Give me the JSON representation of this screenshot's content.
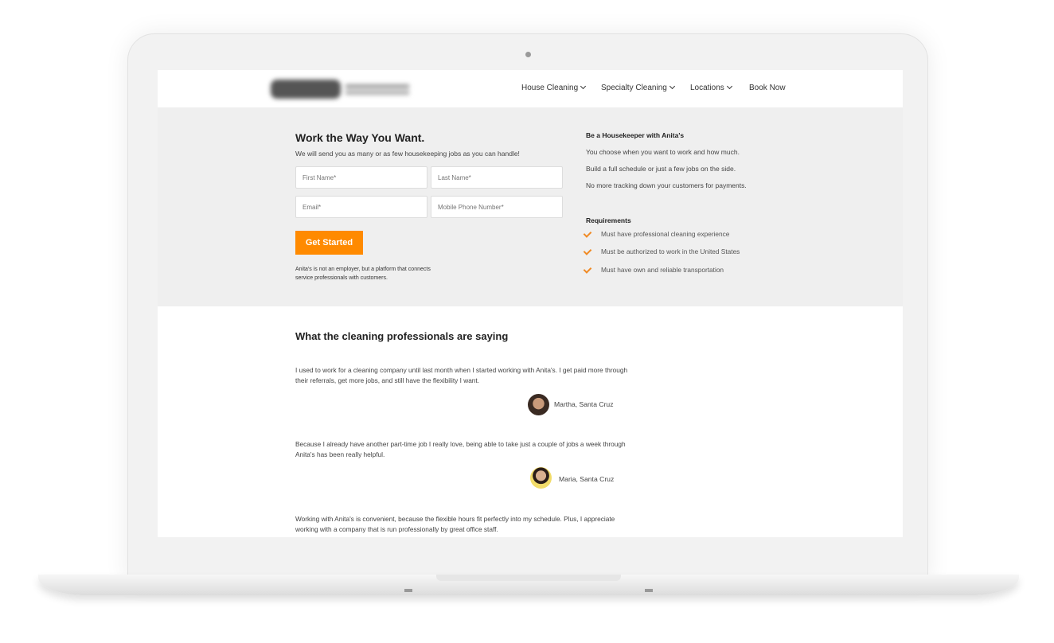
{
  "nav": {
    "logo_text": "Anita's",
    "items": [
      {
        "label": "House Cleaning",
        "dropdown": true
      },
      {
        "label": "Specialty Cleaning",
        "dropdown": true
      },
      {
        "label": "Locations",
        "dropdown": true
      },
      {
        "label": "Book Now",
        "dropdown": false
      }
    ]
  },
  "hero": {
    "title": "Work the Way You Want.",
    "subtitle": "We will send you as many or as few housekeeping jobs as you can handle!",
    "fields": {
      "first_name": "First Name*",
      "last_name": "Last Name*",
      "email": "Email*",
      "phone": "Mobile Phone Number*"
    },
    "button": "Get Started",
    "disclaimer": "Anita's is not an employer, but a platform that connects service professionals with customers.",
    "benefits_title": "Be a Housekeeper with Anita's",
    "benefits": [
      "You choose when you want to work and how much.",
      "Build a full schedule or just a few jobs on the side.",
      "No more tracking down your customers for payments."
    ],
    "requirements_title": "Requirements",
    "requirements": [
      "Must have professional cleaning experience",
      "Must be authorized to work in the United States",
      "Must have own and reliable transportation"
    ]
  },
  "testimonials": {
    "title": "What the cleaning professionals are saying",
    "items": [
      {
        "quote": "I used to work for a cleaning company until last month when I started working with Anita's. I get paid more through their referrals, get more jobs, and still have the flexibility I want.",
        "author": "Martha, Santa Cruz"
      },
      {
        "quote": "Because I already have another part-time job I really love, being able to take just a couple of jobs a week through Anita's has been really helpful.",
        "author": "Maria, Santa Cruz"
      },
      {
        "quote": "Working with Anita's is convenient, because the flexible hours fit perfectly into my schedule. Plus, I appreciate working with a company that is run professionally by great office staff."
      }
    ]
  },
  "colors": {
    "accent": "#ff8a00",
    "check": "#f08a24",
    "hero_bg": "#efefef"
  }
}
